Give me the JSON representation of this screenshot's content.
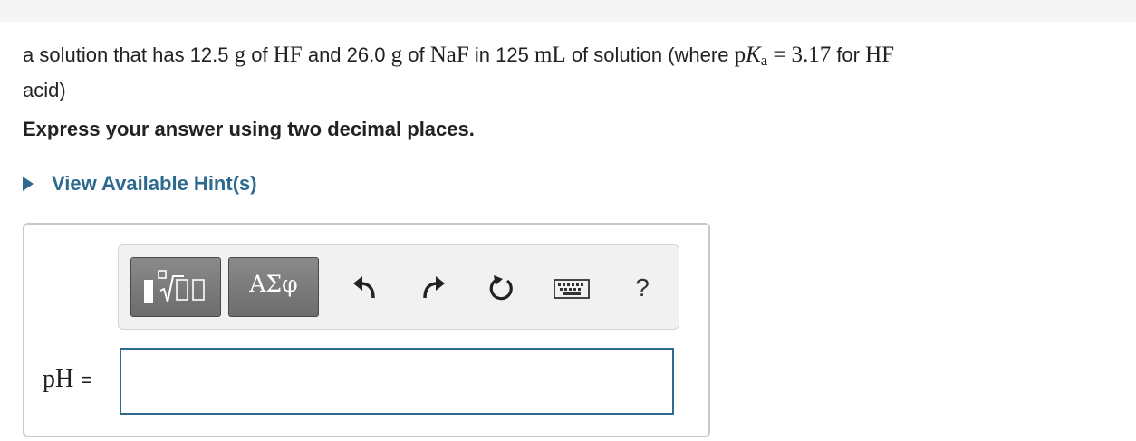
{
  "question": {
    "prefix": "a solution that has 12.5",
    "unit_g1": "g",
    "of1": "of",
    "hf1": "HF",
    "and_mass": "and 26.0",
    "unit_g2": "g",
    "of2": "of",
    "naf": "NaF",
    "in_vol": "in 125",
    "unit_ml": "mL",
    "where_text": "of solution (where",
    "pka_p": "p",
    "pka_K": "K",
    "pka_sub": "a",
    "equals": "=",
    "pka_value": "3.17",
    "for_text": "for",
    "hf2": "HF",
    "suffix": "acid)"
  },
  "instruction": "Express your answer using two decimal places.",
  "hint": {
    "label": "View Available Hint(s)"
  },
  "toolbar": {
    "template_icon": "fraction-sqrt-template-icon",
    "greek_label": "ΑΣφ",
    "undo_icon": "undo-arrow-icon",
    "redo_icon": "redo-arrow-icon",
    "reset_icon": "reset-circular-arrow-icon",
    "keyboard_icon": "keyboard-icon",
    "help_label": "?"
  },
  "answer": {
    "label": "pH",
    "equals": "=",
    "value": ""
  },
  "colors": {
    "accent": "#2d6a8e",
    "button_dark": "#6d6d6d",
    "toolbar_bg": "#f1f1f1"
  }
}
